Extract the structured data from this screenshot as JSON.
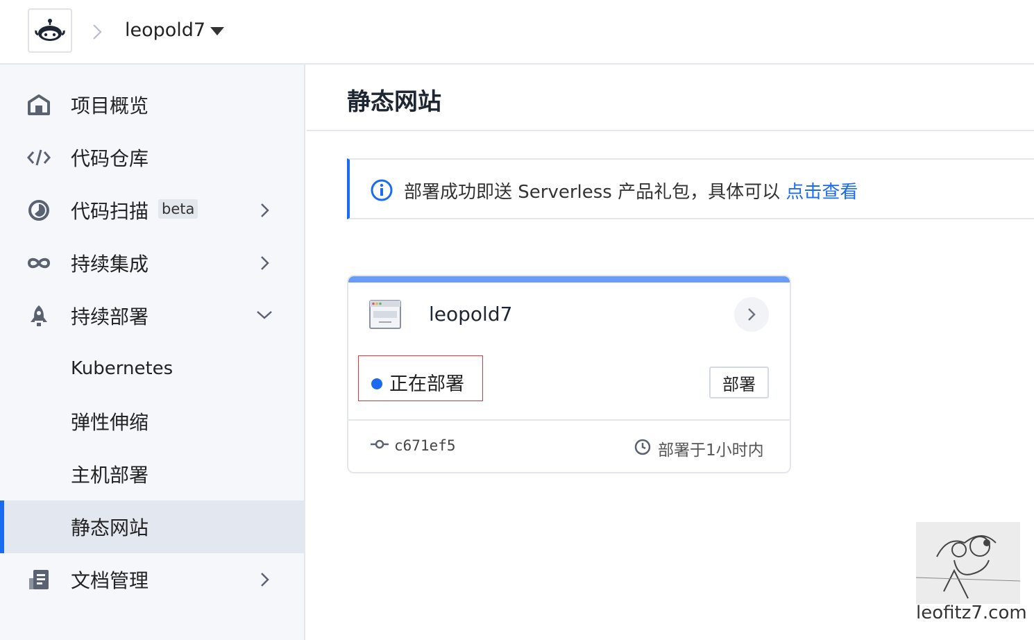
{
  "topbar": {
    "logo": "octopus-logo",
    "project": "leopold7"
  },
  "sidebar": {
    "items": [
      {
        "label": "项目概览",
        "icon": "home-icon"
      },
      {
        "label": "代码仓库",
        "icon": "code-icon"
      },
      {
        "label": "代码扫描",
        "badge": "beta",
        "icon": "scan-icon"
      },
      {
        "label": "持续集成",
        "icon": "infinity-icon"
      },
      {
        "label": "持续部署",
        "icon": "rocket-icon"
      },
      {
        "label": "Kubernetes"
      },
      {
        "label": "弹性伸缩"
      },
      {
        "label": "主机部署"
      },
      {
        "label": "静态网站",
        "active": true
      },
      {
        "label": "文档管理",
        "icon": "document-icon"
      }
    ]
  },
  "main": {
    "title": "静态网站",
    "notice": {
      "text": "部署成功即送 Serverless 产品礼包，具体可以 ",
      "link": "点击查看"
    },
    "card": {
      "name": "leopold7",
      "status": "正在部署",
      "deploy_button": "部署",
      "commit": "c671ef5",
      "deploy_time": "部署于1小时内"
    }
  },
  "watermark": {
    "text": "leofitz7.com"
  },
  "colors": {
    "accent": "#1b6bf2",
    "card_bar": "#6b9cf5",
    "sidebar_bg": "#f5f7fa"
  }
}
